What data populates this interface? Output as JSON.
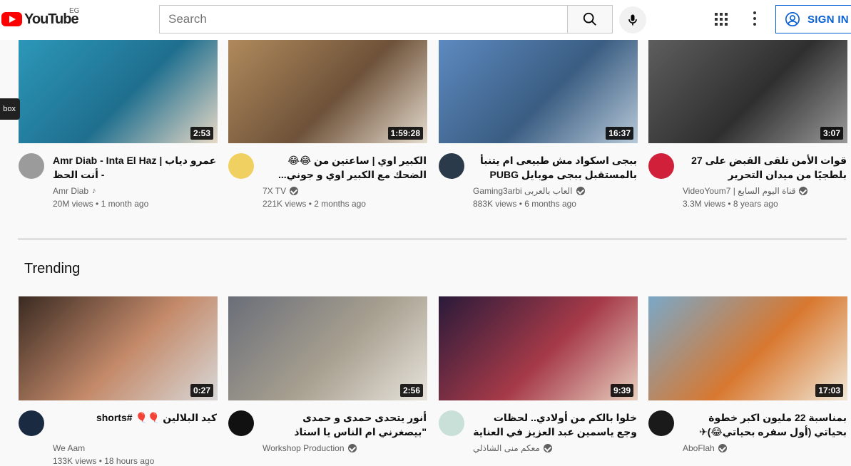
{
  "header": {
    "logo_text": "YouTube",
    "country_code": "EG",
    "search_placeholder": "Search",
    "sign_in_label": "SIGN IN"
  },
  "side_tab_label": "box",
  "row1": [
    {
      "title": "Amr Diab - Inta El Haz | عمرو دياب - أنت الحظ",
      "ltr": true,
      "channel": "Amr Diab",
      "badge": "note",
      "views": "20M views",
      "age": "1 month ago",
      "duration": "2:53",
      "thumb_colors": [
        "#2c97b8",
        "#1f6f8f",
        "#e8d9c6"
      ],
      "avatar_color": "#9b9b9b"
    },
    {
      "title": "الكبير اوي | ساعتين من 😂😂 الضحك مع الكبير اوي و جوني...",
      "ltr": false,
      "channel": "7X TV",
      "badge": "verified",
      "views": "221K views",
      "age": "2 months ago",
      "duration": "1:59:28",
      "thumb_colors": [
        "#b08a5c",
        "#6e5239",
        "#e5dccf"
      ],
      "avatar_color": "#f0d060"
    },
    {
      "title": "ببجى اسكواد مش طبيعى ام يتنبأ بالمستقبل ببجى موبايل PUBG",
      "ltr": false,
      "channel": "Gaming3arbi العاب بالعربى",
      "badge": "verified",
      "views": "883K views",
      "age": "6 months ago",
      "duration": "16:37",
      "thumb_colors": [
        "#5d8ac0",
        "#3a5d82",
        "#b7c9d8"
      ],
      "avatar_color": "#2a3a4a"
    },
    {
      "title": "قوات الأمن تلقى القبض على 27 بلطجيًا من ميدان التحرير",
      "ltr": false,
      "channel": "VideoYoum7 | قناة اليوم السابع",
      "badge": "verified",
      "views": "3.3M views",
      "age": "8 years ago",
      "duration": "3:07",
      "thumb_colors": [
        "#5e5e5e",
        "#2f2f2f",
        "#9a9a9a"
      ],
      "avatar_color": "#d0203a"
    }
  ],
  "section": {
    "title": "Trending"
  },
  "row2": [
    {
      "title": "كيد البلالين 🎈🎈 #shorts",
      "ltr": false,
      "channel": "We Aam",
      "badge": "none",
      "views": "133K views",
      "age": "18 hours ago",
      "duration": "0:27",
      "thumb_colors": [
        "#3a2a22",
        "#c48a6a",
        "#d8d8d8"
      ],
      "avatar_color": "#1a2a40"
    },
    {
      "title": "أنور يتحدى حمدى و حمدى \"بيصغرني ام الناس يا استاذ اشرف\" - مسرح",
      "ltr": false,
      "channel": "Workshop Production",
      "badge": "verified",
      "views": "",
      "age": "",
      "duration": "2:56",
      "thumb_colors": [
        "#6a6e78",
        "#a8a090",
        "#e8e4dc"
      ],
      "avatar_color": "#111111"
    },
    {
      "title": "خلوا بالكم من أولادي.. لحظات وجع ياسمين عبد العزيز في العناية",
      "ltr": false,
      "channel": "معكم منى الشاذلي",
      "badge": "verified",
      "views": "",
      "age": "",
      "duration": "9:39",
      "thumb_colors": [
        "#2a1a3a",
        "#a63a48",
        "#e8d0c0"
      ],
      "avatar_color": "#c8e0d8"
    },
    {
      "title": "بمناسبة 22 مليون اكبر خطوة بحياتي (أول سفره بحياتي😂)✈",
      "ltr": false,
      "channel": "AboFlah",
      "badge": "verified",
      "views": "",
      "age": "",
      "duration": "17:03",
      "thumb_colors": [
        "#7aa8c8",
        "#d87830",
        "#f0e8d8"
      ],
      "avatar_color": "#1a1a1a"
    }
  ]
}
